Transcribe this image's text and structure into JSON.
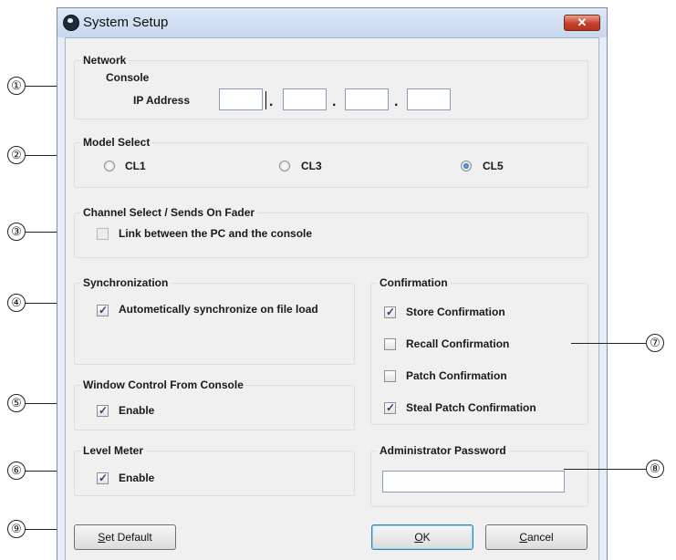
{
  "window": {
    "title": "System Setup",
    "close_glyph": "✕",
    "icons": {
      "app": "app-logo-icon",
      "close": "close-icon"
    }
  },
  "network": {
    "title": "Network",
    "console_label": "Console",
    "ip_label": "IP Address",
    "ip": [
      "",
      "",
      "",
      ""
    ],
    "dot": "."
  },
  "model_select": {
    "title": "Model Select",
    "options": [
      {
        "label": "CL1",
        "selected": false
      },
      {
        "label": "CL3",
        "selected": false
      },
      {
        "label": "CL5",
        "selected": true
      }
    ]
  },
  "channel_select": {
    "title": "Channel Select / Sends On Fader",
    "link_label": "Link between the PC and the console",
    "link_checked": false
  },
  "synchronization": {
    "title": "Synchronization",
    "auto_label": "Autometically synchronize on file load",
    "auto_checked": true
  },
  "window_control": {
    "title": "Window Control From Console",
    "enable_label": "Enable",
    "enable_checked": true
  },
  "level_meter": {
    "title": "Level Meter",
    "enable_label": "Enable",
    "enable_checked": true
  },
  "confirmation": {
    "title": "Confirmation",
    "items": [
      {
        "label": "Store Confirmation",
        "checked": true
      },
      {
        "label": "Recall Confirmation",
        "checked": false
      },
      {
        "label": "Patch Confirmation",
        "checked": false
      },
      {
        "label": "Steal Patch Confirmation",
        "checked": true
      }
    ]
  },
  "admin_password": {
    "title": "Administrator Password",
    "value": ""
  },
  "buttons": {
    "set_default_mnemonic": "S",
    "set_default_rest": "et Default",
    "ok_mnemonic": "O",
    "ok_rest": "K",
    "cancel_mnemonic": "C",
    "cancel_rest": "ancel"
  },
  "callouts": [
    "①",
    "②",
    "③",
    "④",
    "⑤",
    "⑥",
    "⑦",
    "⑧",
    "⑨"
  ]
}
